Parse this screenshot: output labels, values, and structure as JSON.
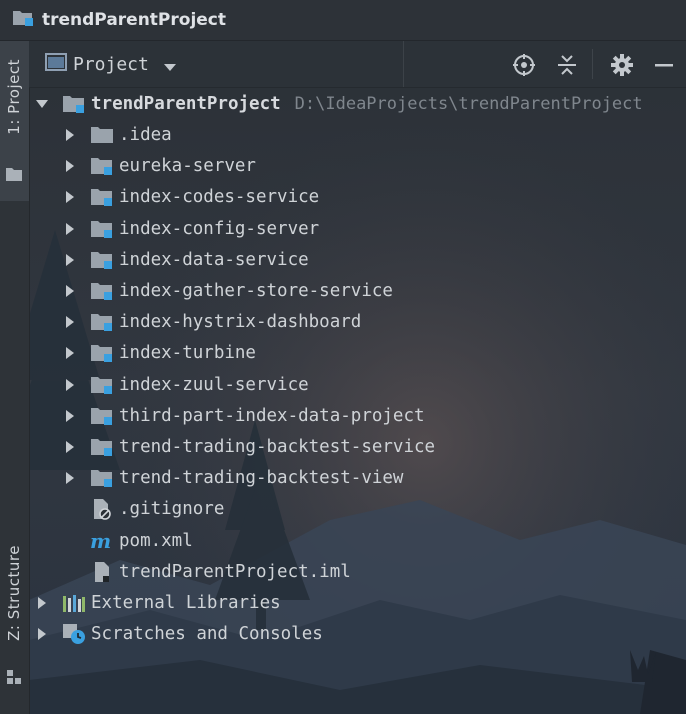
{
  "window": {
    "title": "trendParentProject"
  },
  "left_strip": {
    "project_tab": "1: Project",
    "structure_tab": "Z: Structure"
  },
  "panel": {
    "view_label": "Project"
  },
  "tree": {
    "root": {
      "label": "trendParentProject",
      "path": "D:\\IdeaProjects\\trendParentProject"
    },
    "items": [
      {
        "label": ".idea",
        "kind": "folder"
      },
      {
        "label": "eureka-server",
        "kind": "module"
      },
      {
        "label": "index-codes-service",
        "kind": "module"
      },
      {
        "label": "index-config-server",
        "kind": "module"
      },
      {
        "label": "index-data-service",
        "kind": "module"
      },
      {
        "label": "index-gather-store-service",
        "kind": "module"
      },
      {
        "label": "index-hystrix-dashboard",
        "kind": "module"
      },
      {
        "label": "index-turbine",
        "kind": "module"
      },
      {
        "label": "index-zuul-service",
        "kind": "module"
      },
      {
        "label": "third-part-index-data-project",
        "kind": "module"
      },
      {
        "label": "trend-trading-backtest-service",
        "kind": "module"
      },
      {
        "label": "trend-trading-backtest-view",
        "kind": "module"
      },
      {
        "label": ".gitignore",
        "kind": "gitignore"
      },
      {
        "label": "pom.xml",
        "kind": "maven"
      },
      {
        "label": "trendParentProject.iml",
        "kind": "iml"
      }
    ],
    "external_libraries": "External Libraries",
    "scratches": "Scratches and Consoles"
  },
  "colors": {
    "module_badge": "#3aa0e0",
    "background": "#2b3036"
  }
}
